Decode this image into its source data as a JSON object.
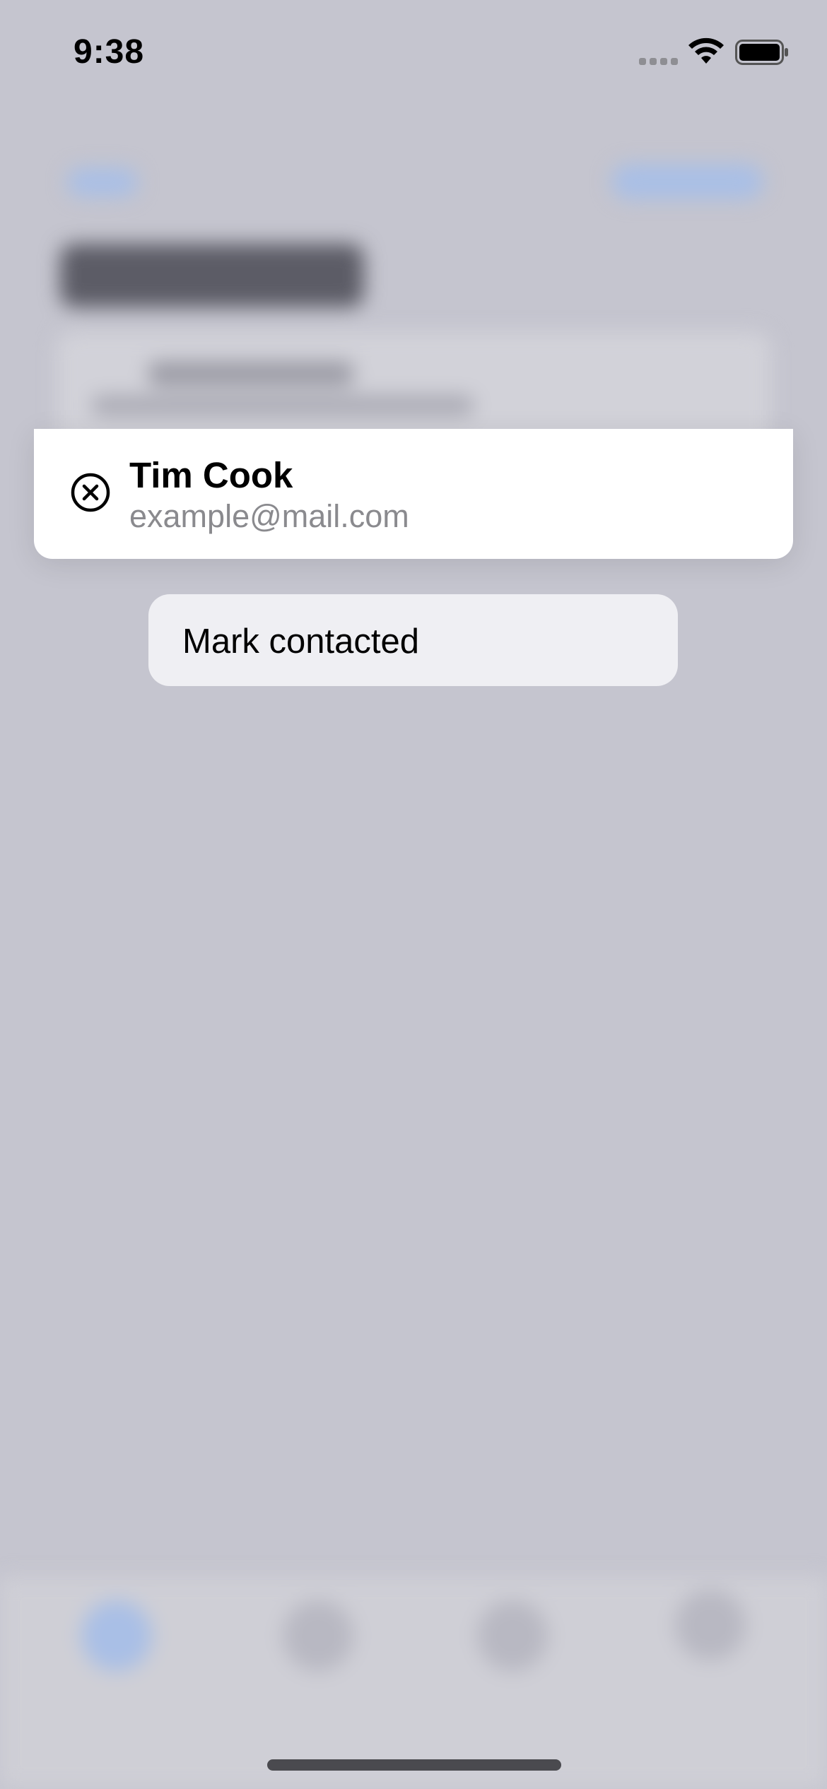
{
  "status_bar": {
    "time": "9:38",
    "signal_icon": "cellular-signal-icon",
    "wifi_icon": "wifi-icon",
    "battery_icon": "battery-icon"
  },
  "preview": {
    "name": "Tim Cook",
    "email": "example@mail.com",
    "icon": "xmark-circle-icon"
  },
  "menu": {
    "items": [
      {
        "label": "Mark contacted"
      }
    ]
  },
  "colors": {
    "background": "#c5c5cf",
    "card": "#ffffff",
    "menu": "#efeff3",
    "secondary_text": "#8a8a8e",
    "accent_blurred": "#a9bfe6"
  }
}
